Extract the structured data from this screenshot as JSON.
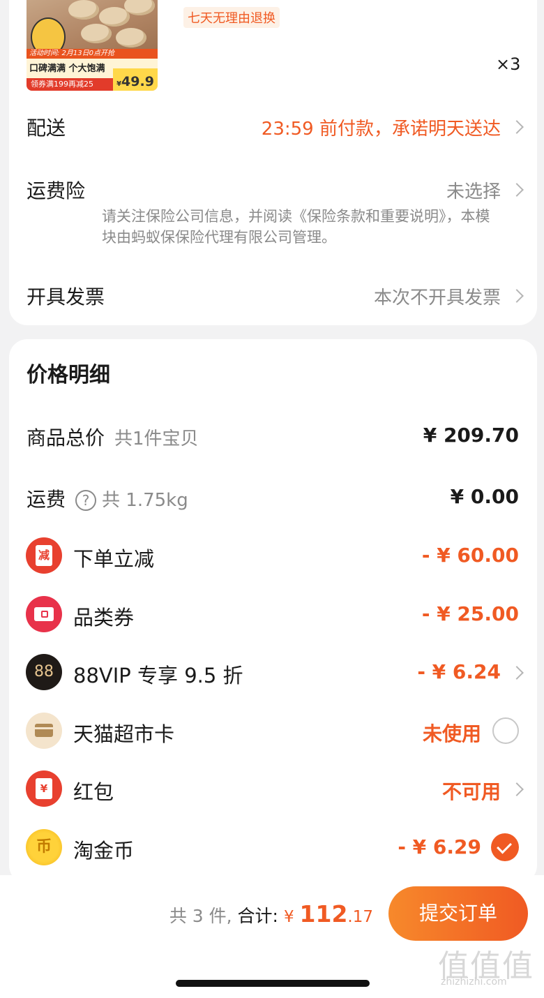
{
  "product": {
    "image_promo_time": "活动时间: 2月13日0点开抢",
    "image_slogan": "口碑满满 个大饱满",
    "image_coupon": "领券满199再减25",
    "image_price": "49.9",
    "image_currency": "¥",
    "return_tag": "七天无理由退换",
    "quantity": "×3"
  },
  "delivery": {
    "label": "配送",
    "value": "23:59 前付款，承诺明天送达"
  },
  "shipping_insurance": {
    "label": "运费险",
    "value": "未选择",
    "note": "请关注保险公司信息，并阅读《保险条款和重要说明》，本模块由蚂蚁保保险代理有限公司管理。"
  },
  "invoice": {
    "label": "开具发票",
    "value": "本次不开具发票"
  },
  "price_detail": {
    "title": "价格明细",
    "goods_total": {
      "label": "商品总价",
      "sub": "共1件宝贝",
      "amount": "¥ 209.70"
    },
    "freight": {
      "label": "运费",
      "help_icon": "?",
      "sub": "共 1.75kg",
      "amount": "¥ 0.00"
    },
    "discounts": [
      {
        "icon": "instant-discount-icon",
        "icon_text": "减",
        "label": "下单立减",
        "amount": "- ¥ 60.00"
      },
      {
        "icon": "ticket-icon",
        "label": "品类券",
        "amount": "- ¥ 25.00"
      },
      {
        "icon": "88vip-icon",
        "icon_text": "88",
        "label": "88VIP 专享 9.5 折",
        "amount": "- ¥ 6.24"
      },
      {
        "icon": "card-icon",
        "label": "天猫超市卡",
        "amount": "未使用"
      },
      {
        "icon": "red-envelope-icon",
        "icon_text": "¥",
        "label": "红包",
        "amount": "不可用"
      },
      {
        "icon": "coin-icon",
        "icon_text": "币",
        "label": "淘金币",
        "amount": "- ¥ 6.29"
      }
    ]
  },
  "footer": {
    "count": "共 3 件,",
    "total_label": "合计:",
    "currency": "¥",
    "total_int": "112",
    "total_dec": ".17",
    "submit": "提交订单",
    "watermark": "值值值",
    "watermark_url": "zhizhizhi.com"
  },
  "colors": {
    "accent": "#f05a23",
    "muted": "#8a8a8a",
    "background": "#f2f2f3"
  }
}
